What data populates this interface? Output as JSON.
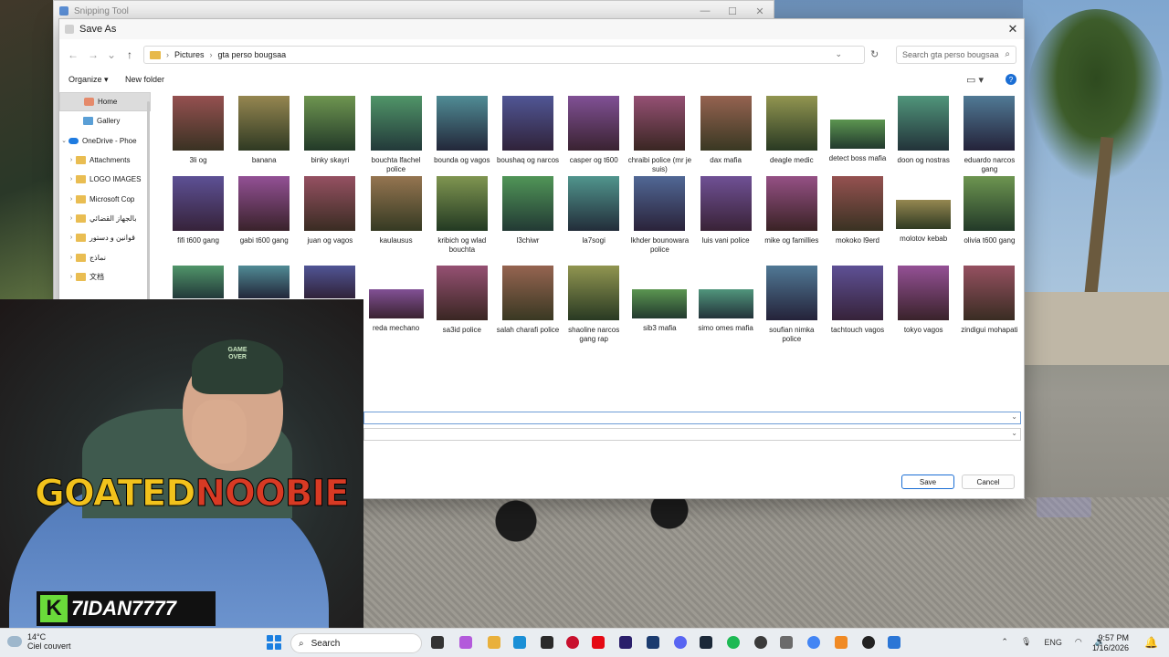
{
  "snipping_tool": {
    "title": "Snipping Tool"
  },
  "dialog": {
    "title": "Save As",
    "address": {
      "segments": [
        "Pictures",
        "gta perso bougsaa"
      ]
    },
    "search_placeholder": "Search gta perso bougsaa",
    "commands": {
      "organize": "Organize",
      "new_folder": "New folder"
    },
    "sidebar": [
      {
        "label": "Home",
        "icon": "home-icon",
        "selected": true
      },
      {
        "label": "Gallery",
        "icon": "gallery-icon"
      },
      {
        "label": "OneDrive - Phoe",
        "icon": "onedrive-icon",
        "expanded": true
      },
      {
        "label": "Attachments",
        "icon": "folder-icon"
      },
      {
        "label": "LOGO IMAGES",
        "icon": "folder-icon"
      },
      {
        "label": "Microsoft Cop",
        "icon": "folder-icon"
      },
      {
        "label": "بالجهاز القضائي",
        "icon": "folder-icon"
      },
      {
        "label": "قوانين و دستور",
        "icon": "folder-icon"
      },
      {
        "label": "نماذج",
        "icon": "folder-icon"
      },
      {
        "label": "文档",
        "icon": "folder-icon"
      }
    ],
    "files": [
      "3li og",
      "banana",
      "binky skayri",
      "bouchta lfachel police",
      "bounda og vagos",
      "boushaq og narcos",
      "casper og t600",
      "chraibi police (mr je suis)",
      "dax mafia",
      "deagle medic",
      "detect boss mafia",
      "doon og nostras",
      "eduardo narcos gang",
      "fifi t600 gang",
      "gabi t600 gang",
      "juan og vagos",
      "kaulausus",
      "kribich og wlad bouchta",
      "l3chiwr",
      "la7sogi",
      "lkhder bounowara police",
      "luis vani police",
      "mike og famillies",
      "mokoko l9erd",
      "molotov kebab",
      "olivia t600 gang",
      "",
      "",
      "",
      "reda mechano",
      "sa3id police",
      "salah charafi police",
      "shaoline narcos gang rap",
      "sib3 mafia",
      "simo omes mafia",
      "soufian nimka police",
      "tachtouch vagos",
      "tokyo vagos",
      "zindigui mohapati"
    ],
    "buttons": {
      "save": "Save",
      "cancel": "Cancel"
    }
  },
  "overlay": {
    "brand_part1": "GOATED",
    "brand_part2": "NOOBIE",
    "handle_badge": "K",
    "handle_name": "7IDAN7777",
    "cap_text": "GAME OVER"
  },
  "taskbar": {
    "weather_temp": "14°C",
    "weather_desc": "Ciel couvert",
    "search_label": "Search",
    "lang": "ENG",
    "time": "9:57 PM",
    "date": "1/16/2026"
  }
}
